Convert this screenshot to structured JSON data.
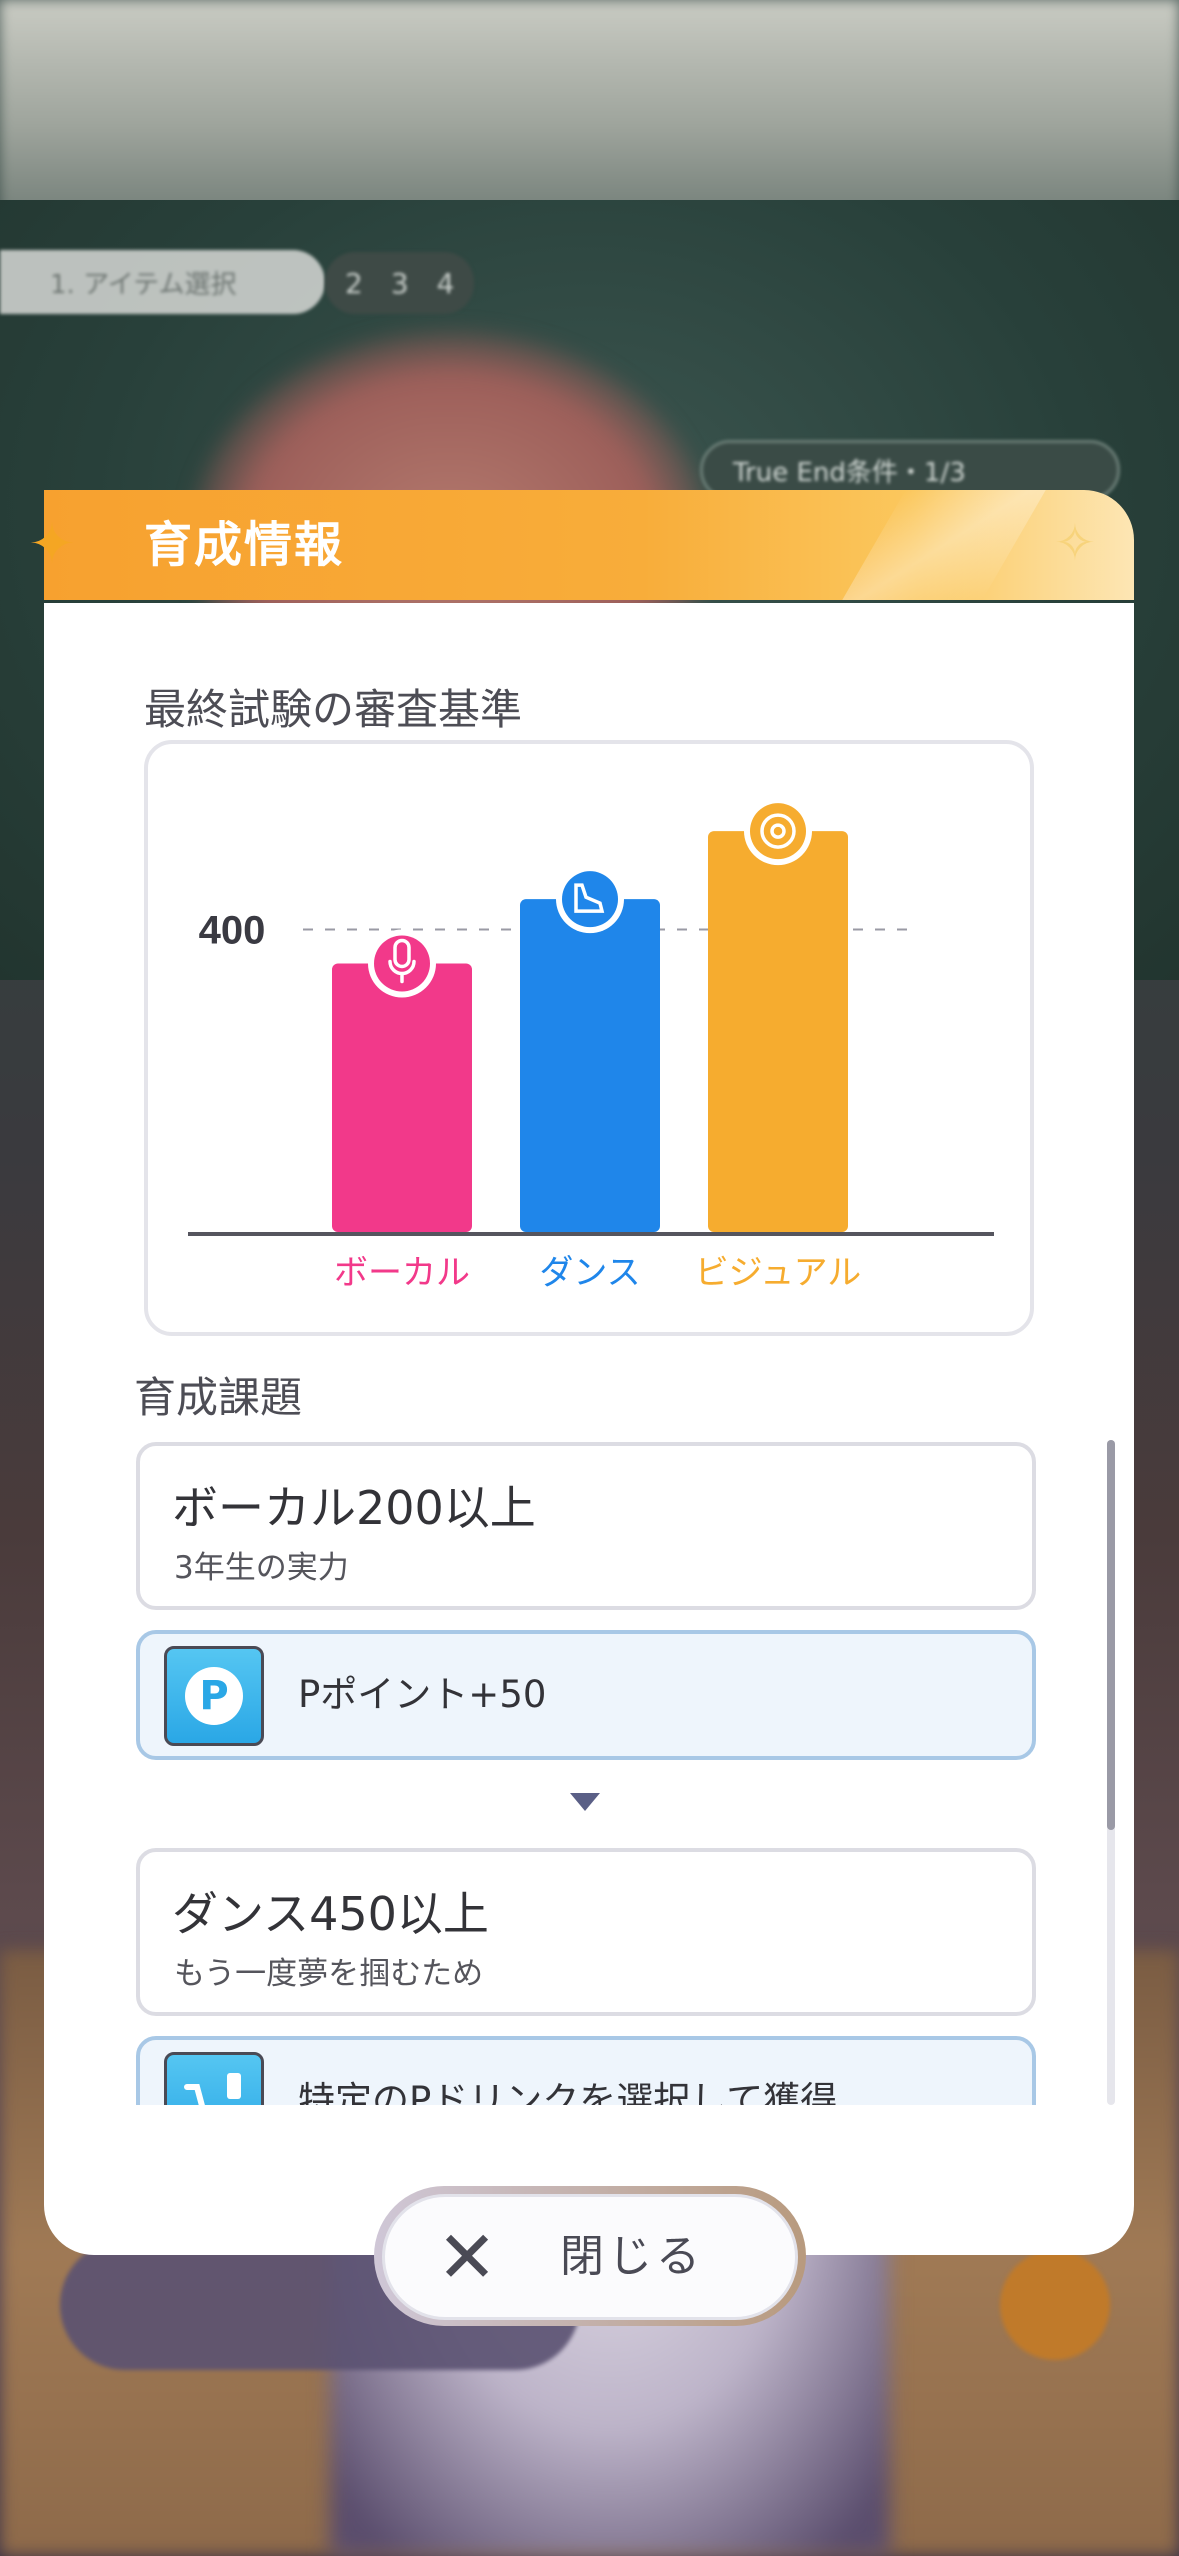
{
  "background": {
    "top_tab_label": "1. アイテム選択",
    "top_tab_numbers": [
      "2",
      "3",
      "4"
    ],
    "true_end_label": "True End条件・1/3"
  },
  "panel": {
    "title": "育成情報"
  },
  "exam": {
    "section_label": "最終試験の審査基準",
    "reference_label": "400"
  },
  "chart_data": {
    "type": "bar",
    "categories": [
      "ボーカル",
      "ダンス",
      "ビジュアル"
    ],
    "values": [
      355,
      440,
      530
    ],
    "reference_line": 400,
    "colors": [
      "#f2398a",
      "#1f86ea",
      "#f6ac2f"
    ],
    "icons": [
      "microphone-icon",
      "shoe-icon",
      "eye-sparkle-icon"
    ]
  },
  "tasks": {
    "section_label": "育成課題",
    "items": [
      {
        "title": "ボーカル200以上",
        "subtitle": "3年生の実力",
        "reward": "Pポイント+50",
        "reward_icon": "p-point-icon"
      },
      {
        "title": "ダンス450以上",
        "subtitle": "もう一度夢を掴むため",
        "reward": "特定のPドリンクを選択して獲得",
        "reward_icon": "drink-cart-icon"
      }
    ]
  },
  "close_button": {
    "label": "閉じる"
  }
}
